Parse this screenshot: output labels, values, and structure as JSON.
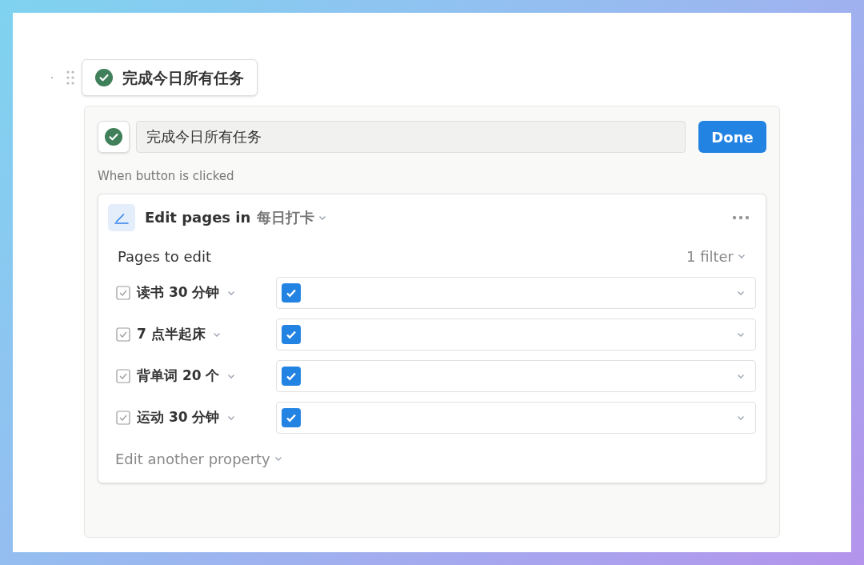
{
  "button_block": {
    "label": "完成今日所有任务"
  },
  "editor": {
    "name_field": {
      "value": "完成今日所有任务"
    },
    "done_button": "Done",
    "trigger_label": "When button is clicked",
    "action": {
      "title": "Edit pages in",
      "database": "每日打卡",
      "pages_label": "Pages to edit",
      "filter": "1 filter",
      "properties": [
        {
          "name": "读书 30 分钟",
          "checked": true
        },
        {
          "name": "7 点半起床",
          "checked": true
        },
        {
          "name": "背单词 20 个",
          "checked": true
        },
        {
          "name": "运动 30 分钟",
          "checked": true
        }
      ],
      "add_property": "Edit another property"
    }
  }
}
